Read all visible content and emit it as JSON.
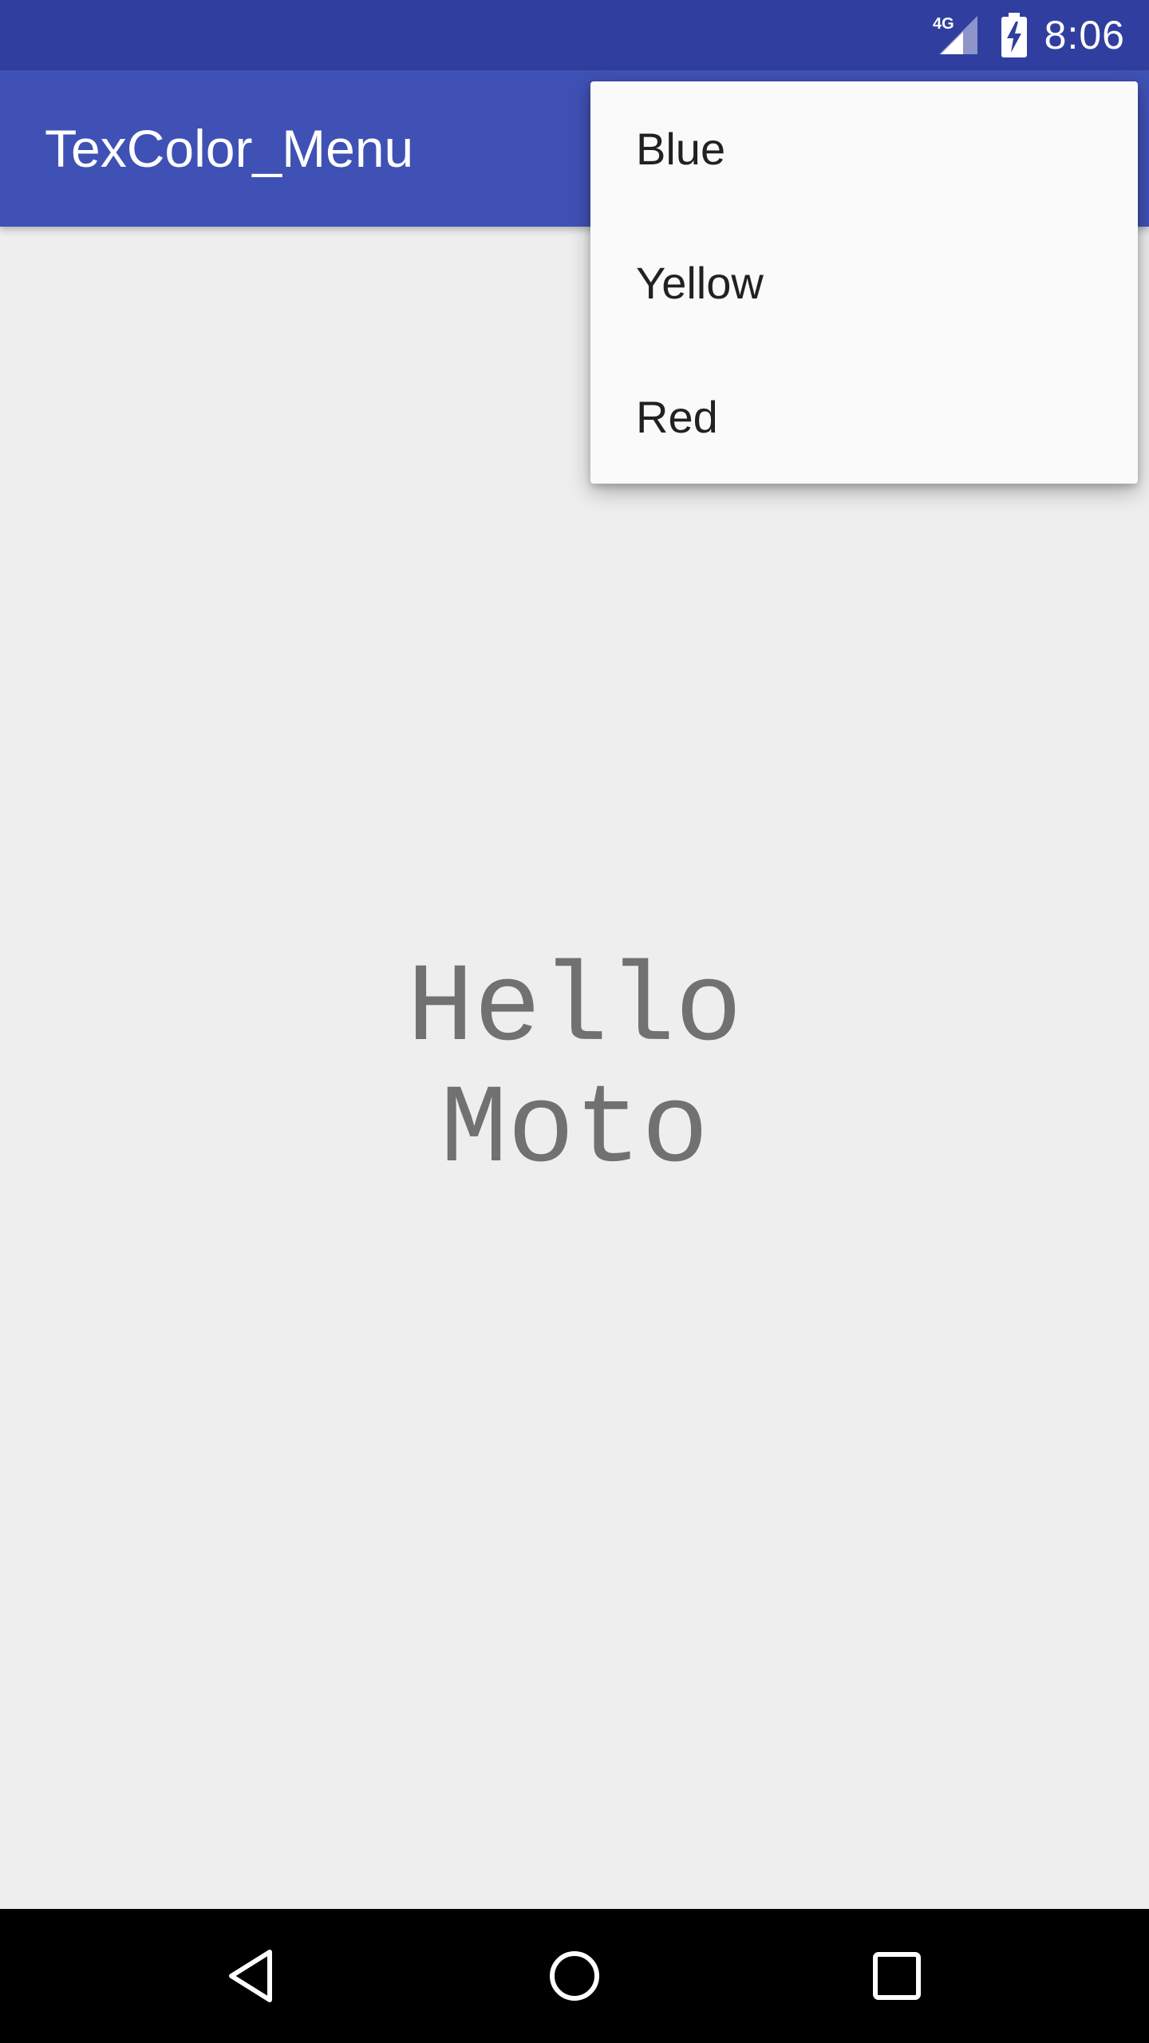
{
  "status_bar": {
    "network_label": "4G",
    "time": "8:06",
    "icons": [
      "signal-4g-icon",
      "battery-charging-icon"
    ],
    "color": "#303f9f"
  },
  "app_bar": {
    "title": "TexColor_Menu",
    "color": "#3f51b5"
  },
  "content": {
    "hello_lines": [
      "Hello",
      "Moto"
    ],
    "text_color": "#717171"
  },
  "overflow_menu": {
    "items": [
      {
        "label": "Blue"
      },
      {
        "label": "Yellow"
      },
      {
        "label": "Red"
      }
    ]
  },
  "nav_bar": {
    "buttons": [
      "back-icon",
      "home-icon",
      "recents-icon"
    ]
  }
}
